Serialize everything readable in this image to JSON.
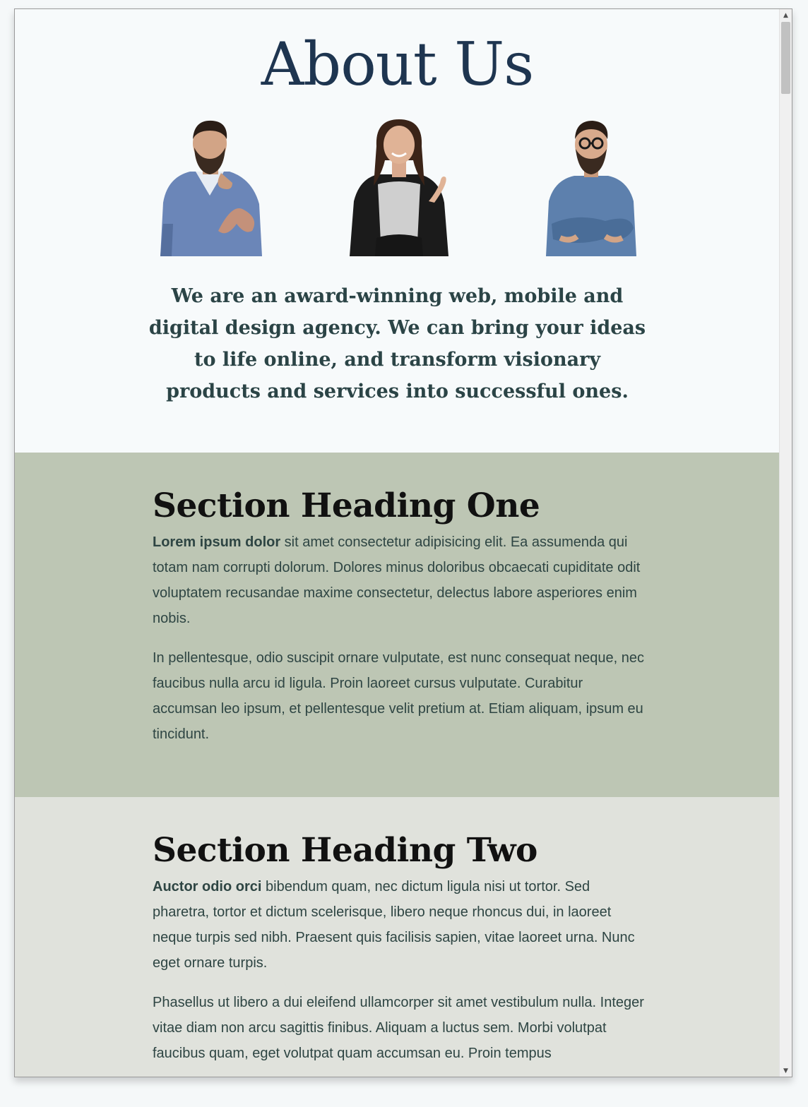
{
  "page": {
    "title": "About Us",
    "intro": "We are an award-winning web, mobile and digital design agency. We can bring your ideas to life online, and transform visionary products and services into successful ones."
  },
  "team": [
    {
      "icon": "man-bearded-thinking-photo"
    },
    {
      "icon": "woman-smiling-photo"
    },
    {
      "icon": "man-glasses-arms-crossed-photo"
    }
  ],
  "sections": [
    {
      "heading": "Section Heading One",
      "p1_bold": "Lorem ipsum dolor",
      "p1_text": " sit amet consectetur adipisicing elit. Ea assumenda qui totam nam corrupti dolorum. Dolores minus doloribus obcaecati cupiditate odit voluptatem recusandae maxime consectetur, delectus labore asperiores enim nobis.",
      "p2": "In pellentesque, odio suscipit ornare vulputate, est nunc consequat neque, nec faucibus nulla arcu id ligula. Proin laoreet cursus vulputate. Curabitur accumsan leo ipsum, et pellentesque velit pretium at. Etiam aliquam, ipsum eu tincidunt."
    },
    {
      "heading": "Section Heading Two",
      "p1_bold": "Auctor odio orci",
      "p1_text": " bibendum quam, nec dictum ligula nisi ut tortor. Sed pharetra, tortor et dictum scelerisque, libero neque rhoncus dui, in laoreet neque turpis sed nibh. Praesent quis facilisis sapien, vitae laoreet urna. Nunc eget ornare turpis.",
      "p2": "Phasellus ut libero a dui eleifend ullamcorper sit amet vestibulum nulla. Integer vitae diam non arcu sagittis finibus. Aliquam a luctus sem. Morbi volutpat faucibus quam, eget volutpat quam accumsan eu. Proin tempus"
    }
  ],
  "scrollbar": {
    "up_glyph": "▲",
    "down_glyph": "▼",
    "position_fraction": 0.0
  },
  "colors": {
    "title": "#1e3550",
    "section_one_bg": "#bdc6b4",
    "section_two_bg": "#e0e2dc",
    "body_text": "#2e4543"
  }
}
